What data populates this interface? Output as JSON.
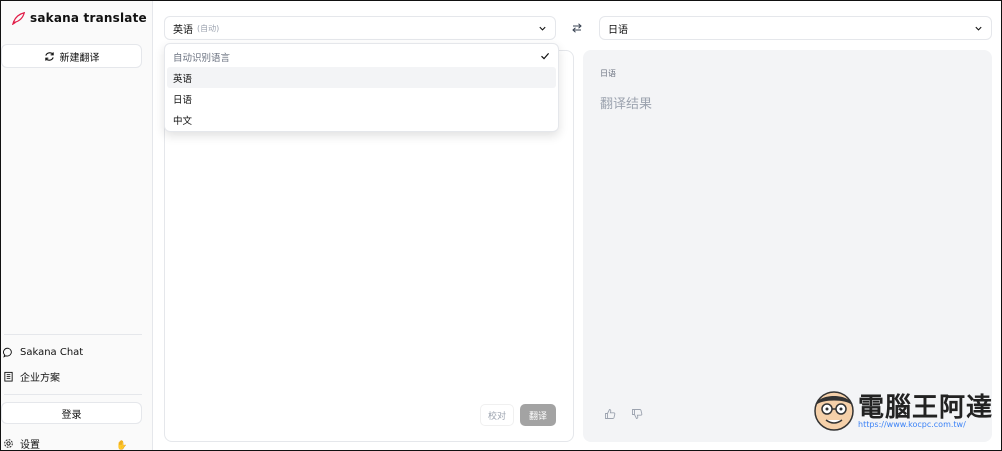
{
  "app": {
    "name": "sakana translate"
  },
  "sidebar": {
    "new_translation": "新建翻译",
    "links": [
      {
        "label": "Sakana Chat",
        "icon": "chat-bubble-icon"
      },
      {
        "label": "企业方案",
        "icon": "building-icon"
      }
    ],
    "login": "登录",
    "settings": "设置"
  },
  "source": {
    "language": "英语",
    "language_sub": "(自动)"
  },
  "target": {
    "language": "日语"
  },
  "dropdown": {
    "options": [
      {
        "label": "自动识别语言",
        "selected": true
      },
      {
        "label": "英语",
        "highlighted": true
      },
      {
        "label": "日语"
      },
      {
        "label": "中文"
      }
    ]
  },
  "actions": {
    "proofread": "校对",
    "translate": "翻译"
  },
  "result": {
    "language_label": "日语",
    "placeholder": "翻译结果"
  },
  "watermark": {
    "title": "電腦王阿達",
    "url": "https://www.kocpc.com.tw/"
  },
  "colors": {
    "accent_logo": "#e11d48",
    "translate_button": "#a3a3a3",
    "result_panel": "#f3f4f6"
  }
}
